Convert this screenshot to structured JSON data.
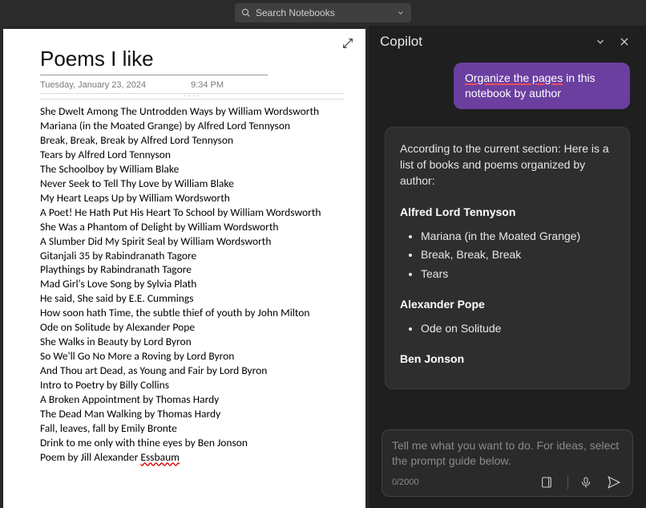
{
  "titlebar": {
    "search_placeholder": "Search Notebooks"
  },
  "note": {
    "title": "Poems I like",
    "date": "Tuesday, January 23, 2024",
    "time": "9:34 PM",
    "lines": [
      "She Dwelt Among The Untrodden Ways by William Wordsworth",
      "Mariana (in the Moated Grange) by Alfred Lord Tennyson",
      "Break, Break, Break by Alfred Lord Tennyson",
      "Tears by Alfred Lord Tennyson",
      "The Schoolboy by William Blake",
      "Never Seek to Tell Thy Love by William Blake",
      "My Heart Leaps Up by William Wordsworth",
      "A Poet! He Hath Put His Heart To School by William Wordsworth",
      "She Was a Phantom of Delight by William Wordsworth",
      "A Slumber Did My Spirit Seal by William Wordsworth",
      "Gitanjali 35 by Rabindranath Tagore",
      "Playthings by Rabindranath Tagore",
      "Mad Girl's Love Song by Sylvia Plath",
      "He said, She said by E.E. Cummings",
      "How soon hath Time, the subtle thief of youth by John Milton",
      "Ode on Solitude by Alexander Pope",
      "She Walks in Beauty by Lord Byron",
      "So We'll Go No More a Roving by Lord Byron",
      "And Thou art Dead, as Young and Fair by Lord Byron",
      "Intro to Poetry by Billy Collins",
      "A Broken Appointment by Thomas Hardy",
      "The Dead Man Walking by Thomas Hardy",
      "Fall, leaves, fall by Emily Bronte",
      "Drink to me only with thine eyes by Ben Jonson",
      "Poem by Jill Alexander Essbaum"
    ],
    "misspell_word": "Essbaum"
  },
  "copilot": {
    "title": "Copilot",
    "user_msg_pre": "Organize the pages",
    "user_msg_post": " in this notebook by author",
    "assist_intro": "According to the current section: Here is a list of books and poems organized by author:",
    "groups": [
      {
        "author": "Alfred Lord Tennyson",
        "items": [
          "Mariana (in the Moated Grange)",
          "Break, Break, Break",
          "Tears"
        ]
      },
      {
        "author": "Alexander Pope",
        "items": [
          "Ode on Solitude"
        ]
      },
      {
        "author": "Ben Jonson",
        "items": []
      }
    ],
    "input_placeholder": "Tell me what you want to do. For ideas, select the prompt guide below.",
    "char_count": "0/2000"
  }
}
